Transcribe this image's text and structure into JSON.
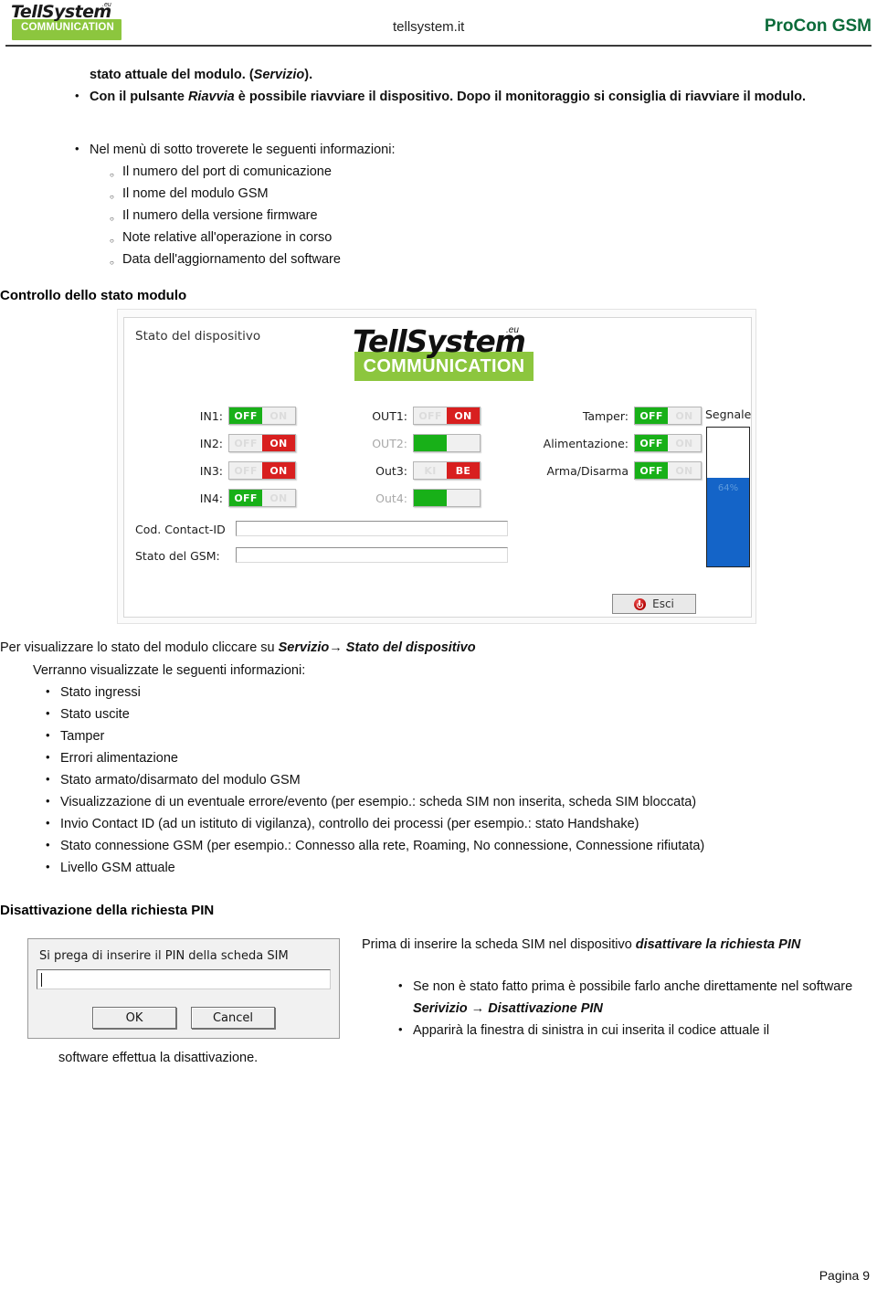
{
  "header": {
    "logo_word": "TellSystem",
    "logo_eu": ".eu",
    "logo_subtitle": "COMMUNICATION",
    "site": "tellsystem.it",
    "product": "ProCon GSM",
    "product_color": "#0b6b3a"
  },
  "top_text": {
    "lead": "stato attuale del modulo. (Servizio).",
    "lead_italic": "Servizio",
    "bullet_restart_pre": "Con il pulsante ",
    "bullet_restart_italic": "Riavvia",
    "bullet_restart_post": " è possibile riavviare il dispositivo. Dopo il monitoraggio si consiglia di riavviare il modulo.",
    "bullet_menu": "Nel menù di sotto troverete le seguenti informazioni:",
    "sub_items": [
      "Il numero del port di comunicazione",
      "Il nome del modulo GSM",
      "Il numero della versione firmware",
      "Note relative all'operazione in corso",
      "Data dell'aggiornamento del software"
    ]
  },
  "section_status": {
    "heading": "Controllo dello stato modulo"
  },
  "device_dialog": {
    "title": "Stato del dispositivo",
    "logo_word": "TellSystem",
    "logo_eu": ".eu",
    "logo_subtitle": "COMMUNICATION",
    "inputs": [
      {
        "label": "IN1:",
        "left_text": "OFF",
        "right_text": "ON",
        "state": "off",
        "dimmed": false
      },
      {
        "label": "IN2:",
        "left_text": "OFF",
        "right_text": "ON",
        "state": "on",
        "dimmed": false
      },
      {
        "label": "IN3:",
        "left_text": "OFF",
        "right_text": "ON",
        "state": "on",
        "dimmed": false
      },
      {
        "label": "IN4:",
        "left_text": "OFF",
        "right_text": "ON",
        "state": "off",
        "dimmed": false
      }
    ],
    "outputs": [
      {
        "label": "OUT1:",
        "left_text": "OFF",
        "right_text": "ON",
        "state": "on",
        "dimmed": false
      },
      {
        "label": "OUT2:",
        "left_text": "",
        "right_text": "",
        "state": "off",
        "dimmed": true
      },
      {
        "label": "Out3:",
        "left_text": "KI",
        "right_text": "BE",
        "state": "on",
        "dimmed": false
      },
      {
        "label": "Out4:",
        "left_text": "",
        "right_text": "",
        "state": "off",
        "dimmed": true
      }
    ],
    "statuses": [
      {
        "label": "Tamper:",
        "left_text": "OFF",
        "right_text": "ON",
        "state": "off",
        "dimmed": false
      },
      {
        "label": "Alimentazione:",
        "left_text": "OFF",
        "right_text": "ON",
        "state": "off",
        "dimmed": false
      },
      {
        "label": "Arma/Disarma",
        "left_text": "OFF",
        "right_text": "ON",
        "state": "off",
        "dimmed": false
      }
    ],
    "signal": {
      "label": "Segnale",
      "percent_text": "64%",
      "percent_value": 64,
      "fill_color": "#1464c8"
    },
    "fields": [
      {
        "label": "Cod. Contact-ID",
        "value": ""
      },
      {
        "label": "Stato del GSM:",
        "value": ""
      }
    ],
    "exit_button": "Esci"
  },
  "mid_text": {
    "line1_pre": "Per visualizzare lo stato del modulo cliccare su ",
    "line1_bold1": "Servizio",
    "line1_arrow": "→",
    "line1_bold2": " Stato del dispositivo",
    "line2": "Verranno visualizzate le seguenti informazioni:",
    "bullets": [
      "Stato ingressi",
      "Stato uscite",
      "Tamper",
      "Errori alimentazione",
      "Stato armato/disarmato del modulo GSM",
      "Visualizzazione di un eventuale errore/evento  (per esempio.: scheda SIM non inserita, scheda SIM bloccata)",
      "Invio Contact ID (ad un istituto di vigilanza), controllo dei processi (per esempio.: stato Handshake)",
      "Stato connessione GSM  (per esempio.: Connesso alla rete, Roaming, No connessione, Connessione rifiutata)",
      "Livello GSM attuale"
    ]
  },
  "section_pin": {
    "heading": "Disattivazione della richiesta PIN"
  },
  "pin_dialog": {
    "message": "Si prega di inserire il PIN della scheda SIM",
    "input_value": "",
    "ok_label": "OK",
    "cancel_label": "Cancel"
  },
  "pin_text": {
    "intro_pre": "Prima di inserire la scheda SIM nel dispositivo ",
    "intro_bold": "disattivare la richiesta PIN",
    "bullet1_pre": "Se non è stato fatto prima è possibile farlo anche direttamente nel software ",
    "bullet1_bold": "Serivizio → Disattivazione PIN",
    "bullet2": "Apparirà la finestra di sinistra in cui inserita il codice attuale il",
    "trailing": "software effettua la disattivazione."
  },
  "footer": {
    "page": "Pagina 9"
  }
}
